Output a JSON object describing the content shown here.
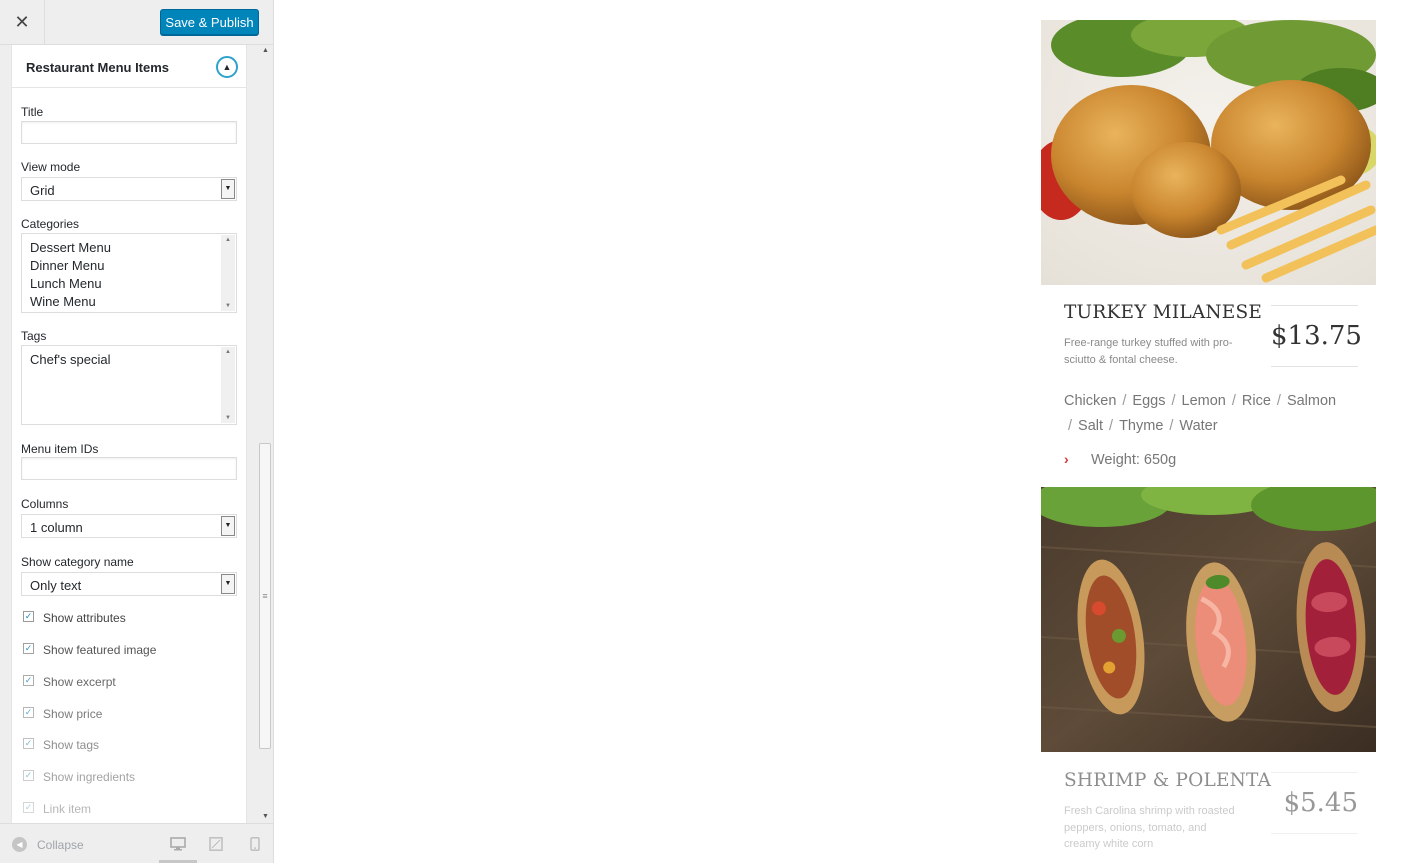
{
  "header": {
    "close_label": "✕",
    "publish_label": "Save & Publish"
  },
  "widget": {
    "title": "Restaurant Menu Items",
    "fields": {
      "title_label": "Title",
      "title_value": "",
      "view_mode_label": "View mode",
      "view_mode_value": "Grid",
      "categories_label": "Categories",
      "categories": [
        "Dessert Menu",
        "Dinner Menu",
        "Lunch Menu",
        "Wine Menu"
      ],
      "tags_label": "Tags",
      "tags": [
        "Chef's special"
      ],
      "menu_item_ids_label": "Menu item IDs",
      "menu_item_ids_value": "",
      "columns_label": "Columns",
      "columns_value": "1 column",
      "show_category_label": "Show category name",
      "show_category_value": "Only text"
    },
    "checkboxes": [
      {
        "label": "Show attributes",
        "checked": true
      },
      {
        "label": "Show featured image",
        "checked": true
      },
      {
        "label": "Show excerpt",
        "checked": true
      },
      {
        "label": "Show price",
        "checked": true
      },
      {
        "label": "Show tags",
        "checked": true
      },
      {
        "label": "Show ingredients",
        "checked": true
      },
      {
        "label": "Link item",
        "checked": true
      }
    ]
  },
  "footer": {
    "collapse_label": "Collapse",
    "devices": [
      "desktop-icon",
      "tablet-icon",
      "mobile-icon"
    ]
  },
  "preview": {
    "items": [
      {
        "name": "TURKEY MILANESE",
        "description": "Free-range turkey stuffed with pro-sciutto & fontal cheese.",
        "price": "$13.75",
        "ingredients": [
          "Chicken",
          "Eggs",
          "Lemon",
          "Rice",
          "Salmon",
          "Salt",
          "Thyme",
          "Water"
        ],
        "weight": "Weight: 650g"
      },
      {
        "name": "SHRIMP & POLENTA",
        "description": "Fresh Carolina shrimp with roasted peppers, onions, tomato, and creamy white corn",
        "price": "$5.45"
      }
    ]
  },
  "colors": {
    "accent": "#0085ba",
    "toggle_ring": "#2ea2cc",
    "weight_arrow": "#d23636"
  }
}
